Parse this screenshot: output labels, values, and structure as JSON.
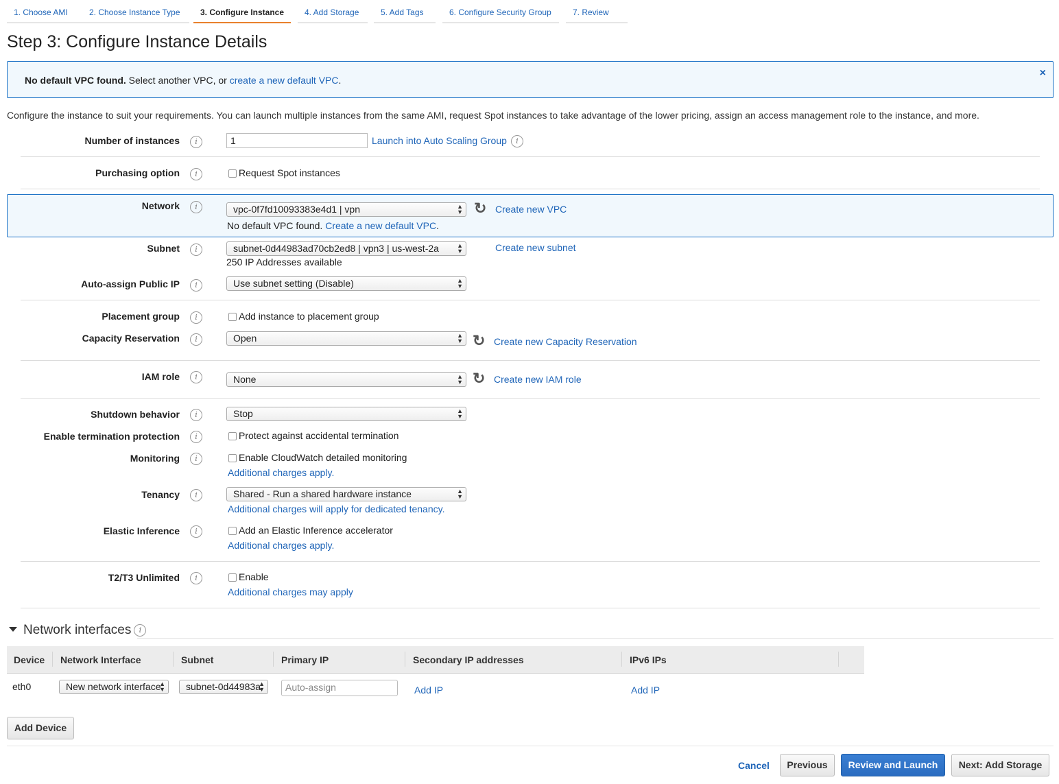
{
  "tabs": [
    {
      "label": "1. Choose AMI"
    },
    {
      "label": "2. Choose Instance Type"
    },
    {
      "label": "3. Configure Instance"
    },
    {
      "label": "4. Add Storage"
    },
    {
      "label": "5. Add Tags"
    },
    {
      "label": "6. Configure Security Group"
    },
    {
      "label": "7. Review"
    }
  ],
  "page_title": "Step 3: Configure Instance Details",
  "alert": {
    "bold": "No default VPC found.",
    "text": " Select another VPC, or ",
    "link": "create a new default VPC",
    "end": ".",
    "close": "×"
  },
  "description": "Configure the instance to suit your requirements. You can launch multiple instances from the same AMI, request Spot instances to take advantage of the lower pricing, assign an access management role to the instance, and more.",
  "fields": {
    "instances": {
      "label": "Number of instances",
      "value": "1",
      "link": "Launch into Auto Scaling Group"
    },
    "purchasing": {
      "label": "Purchasing option",
      "checkbox": "Request Spot instances"
    },
    "network": {
      "label": "Network",
      "value": "vpc-0f7fd10093383e4d1 | vpn",
      "link": "Create new VPC",
      "note": "No default VPC found.",
      "note_link": "Create a new default VPC",
      "note_end": "."
    },
    "subnet": {
      "label": "Subnet",
      "value": "subnet-0d44983ad70cb2ed8 | vpn3 | us-west-2a",
      "note": "250 IP Addresses available",
      "link": "Create new subnet"
    },
    "public_ip": {
      "label": "Auto-assign Public IP",
      "value": "Use subnet setting (Disable)"
    },
    "placement": {
      "label": "Placement group",
      "checkbox": "Add instance to placement group"
    },
    "capacity": {
      "label": "Capacity Reservation",
      "value": "Open",
      "link": "Create new Capacity Reservation"
    },
    "iam": {
      "label": "IAM role",
      "value": "None",
      "link": "Create new IAM role"
    },
    "shutdown": {
      "label": "Shutdown behavior",
      "value": "Stop"
    },
    "termination": {
      "label": "Enable termination protection",
      "checkbox": "Protect against accidental termination"
    },
    "monitoring": {
      "label": "Monitoring",
      "checkbox": "Enable CloudWatch detailed monitoring",
      "link": "Additional charges apply."
    },
    "tenancy": {
      "label": "Tenancy",
      "value": "Shared - Run a shared hardware instance",
      "link": "Additional charges will apply for dedicated tenancy."
    },
    "elastic": {
      "label": "Elastic Inference",
      "checkbox": "Add an Elastic Inference accelerator",
      "link": "Additional charges apply."
    },
    "t2t3": {
      "label": "T2/T3 Unlimited",
      "checkbox": "Enable",
      "link": "Additional charges may apply"
    }
  },
  "network_interfaces": {
    "title": "Network interfaces",
    "headers": [
      "Device",
      "Network Interface",
      "Subnet",
      "Primary IP",
      "Secondary IP addresses",
      "IPv6 IPs"
    ],
    "row": {
      "device": "eth0",
      "interface": "New network interface",
      "subnet": "subnet-0d44983a",
      "primary_placeholder": "Auto-assign",
      "secondary_link": "Add IP",
      "ipv6_link": "Add IP"
    },
    "add_device": "Add Device"
  },
  "footer": {
    "cancel": "Cancel",
    "previous": "Previous",
    "review": "Review and Launch",
    "next": "Next: Add Storage"
  },
  "colors": {
    "accent": "#1f74c7",
    "tab_active": "#e8802c",
    "primary_button": "#2a6cc0"
  }
}
